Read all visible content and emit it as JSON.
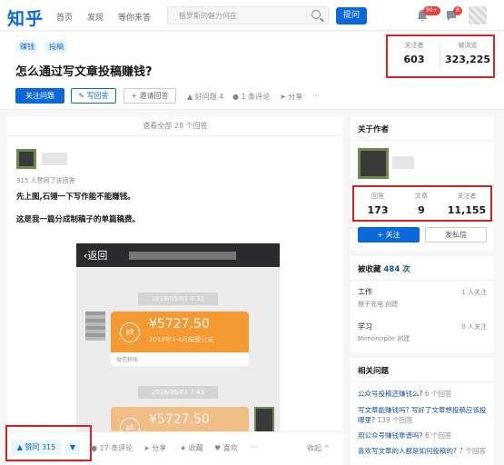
{
  "nav": {
    "logo": "知乎",
    "home": "首页",
    "discover": "发现",
    "waiting": "等你来答",
    "search_placeholder": "俄罗斯的魅力何在",
    "ask": "提问",
    "notif_count": "99+",
    "msg_count": "8"
  },
  "question": {
    "tags": [
      "赚钱",
      "投稿"
    ],
    "title": "怎么通过写文章投稿赚钱?",
    "follow": "关注问题",
    "write": "✎ 写回答",
    "invite": "+ 邀请回答",
    "good": "好问题 4",
    "comments": "1 条评论",
    "share": "分享",
    "more": "···",
    "followers_label": "关注者",
    "followers": "603",
    "views_label": "被浏览",
    "views": "323,225"
  },
  "answer": {
    "view_all": "查看全部 28 个回答",
    "approved": "315 人赞同了该回答",
    "p1": "先上图,石锤一下写作能不能赚钱。",
    "p2": "这是我一篇分成制稿子的单篇稿费。",
    "back": "返回",
    "ts1": "2018/05/01 0:31",
    "amount1": "¥5727.50",
    "sub1": "2018年1-4月稿费分成",
    "wechat": "微信转账",
    "ts2": "2018/05/01 7:43",
    "amount2": "¥5727.50",
    "vote": "▲ 赞同 315",
    "down": "▼",
    "comments": "17 条评论",
    "share": "分享",
    "collect": "收藏",
    "like": "喜欢",
    "more": "···",
    "collapse": "收起 ^"
  },
  "author": {
    "title": "关于作者",
    "answers_label": "回答",
    "answers": "173",
    "articles_label": "文章",
    "articles": "9",
    "followers_label": "关注者",
    "followers": "11,155",
    "follow": "+ 关注",
    "pm": "发私信"
  },
  "collect": {
    "title": "被收藏",
    "count": "484 次",
    "c1": "工作",
    "c1_owner": "橙子充电 创建",
    "c1_f": "1 人关注",
    "c2": "学习",
    "c2_owner": "Mimorinpile 创建",
    "c2_f": "0 人关注"
  },
  "related": {
    "title": "相关问题",
    "q1": "公众号投稿还赚钱么?",
    "q1_c": "6 个回答",
    "q2": "写文章能赚钱吗? 写好了文章想投稿应该投哪里?",
    "q2_c": "139 个回答",
    "q3": "用公众号赚钱靠谱吗?",
    "q3_c": "6 个回答",
    "q4": "喜欢写文章的人都是如何投稿的?",
    "q4_c": "7 个回答"
  }
}
